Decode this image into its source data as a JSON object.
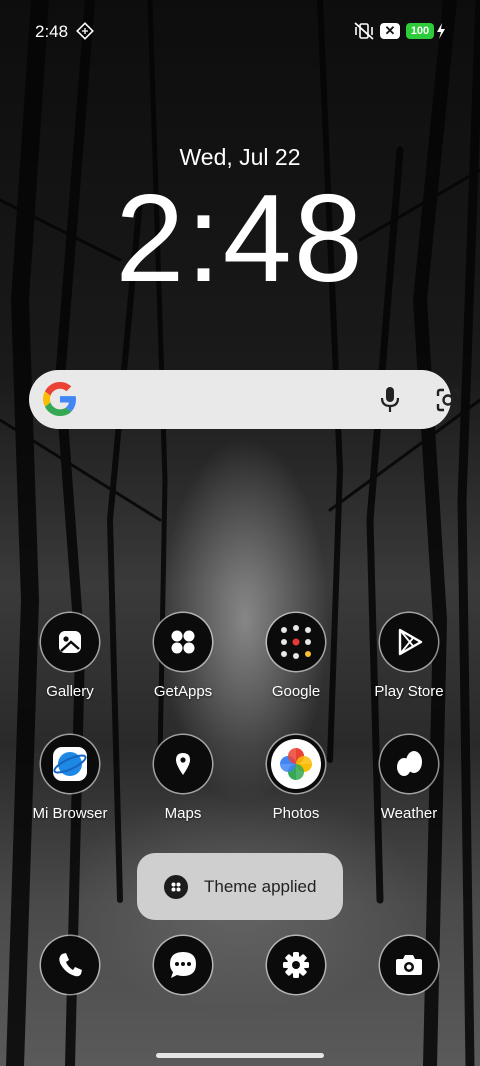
{
  "status_bar": {
    "time": "2:48",
    "notification_icon": "diamond-grid-icon",
    "vibrate_off_icon": "vibrate-off-icon",
    "signal_x_label": "✕",
    "battery_level": "100",
    "charging_icon": "bolt-icon"
  },
  "clock": {
    "date": "Wed, Jul 22",
    "time": "2:48"
  },
  "search_bar": {
    "logo_icon": "google-g-icon",
    "mic_icon": "microphone-icon",
    "lens_icon": "google-lens-icon"
  },
  "apps": [
    {
      "label": "Gallery",
      "icon": "gallery-icon"
    },
    {
      "label": "GetApps",
      "icon": "getapps-icon"
    },
    {
      "label": "Google",
      "icon": "google-folder-icon"
    },
    {
      "label": "Play Store",
      "icon": "play-store-icon"
    },
    {
      "label": "Mi Browser",
      "icon": "browser-icon"
    },
    {
      "label": "Maps",
      "icon": "maps-icon"
    },
    {
      "label": "Photos",
      "icon": "photos-icon"
    },
    {
      "label": "Weather",
      "icon": "weather-icon"
    }
  ],
  "toast": {
    "text": "Theme applied",
    "icon": "theme-icon"
  },
  "dock": [
    {
      "icon": "phone-icon"
    },
    {
      "icon": "messages-icon"
    },
    {
      "icon": "settings-icon"
    },
    {
      "icon": "camera-icon"
    }
  ]
}
